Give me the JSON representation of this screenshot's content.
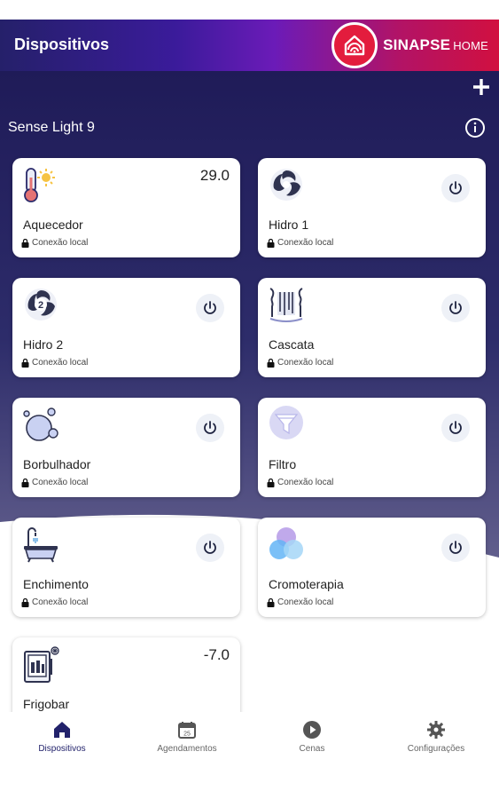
{
  "app": {
    "title": "Dispositivos"
  },
  "logo": {
    "brand": "SINAPSE",
    "suffix": "HOME"
  },
  "section": {
    "title": "Sense Light 9"
  },
  "devices": [
    {
      "name": "Aquecedor",
      "connection": "Conexão local",
      "value": "29.0",
      "icon": "thermometer-sun-icon"
    },
    {
      "name": "Hidro 1",
      "connection": "Conexão local",
      "icon": "hydro-swirl-icon"
    },
    {
      "name": "Hidro 2",
      "connection": "Conexão local",
      "icon": "hydro-2-icon"
    },
    {
      "name": "Cascata",
      "connection": "Conexão local",
      "icon": "waterfall-icon"
    },
    {
      "name": "Borbulhador",
      "connection": "Conexão local",
      "icon": "bubbles-icon"
    },
    {
      "name": "Filtro",
      "connection": "Conexão local",
      "icon": "filter-icon"
    },
    {
      "name": "Enchimento",
      "connection": "Conexão local",
      "icon": "bathtub-fill-icon"
    },
    {
      "name": "Cromoterapia",
      "connection": "Conexão local",
      "icon": "chromotherapy-icon"
    },
    {
      "name": "Frigobar",
      "value": "-7.0",
      "icon": "minibar-icon"
    }
  ],
  "nav": [
    {
      "label": "Dispositivos",
      "icon": "home-icon",
      "active": true
    },
    {
      "label": "Agendamentos",
      "icon": "calendar-icon"
    },
    {
      "label": "Cenas",
      "icon": "play-icon"
    },
    {
      "label": "Configurações",
      "icon": "gear-icon"
    }
  ],
  "colors": {
    "header_start": "#25206a",
    "header_end": "#d11040",
    "background_dark": "#221f5e",
    "nav_active": "#22226b",
    "power_bg": "#eef1f7"
  }
}
